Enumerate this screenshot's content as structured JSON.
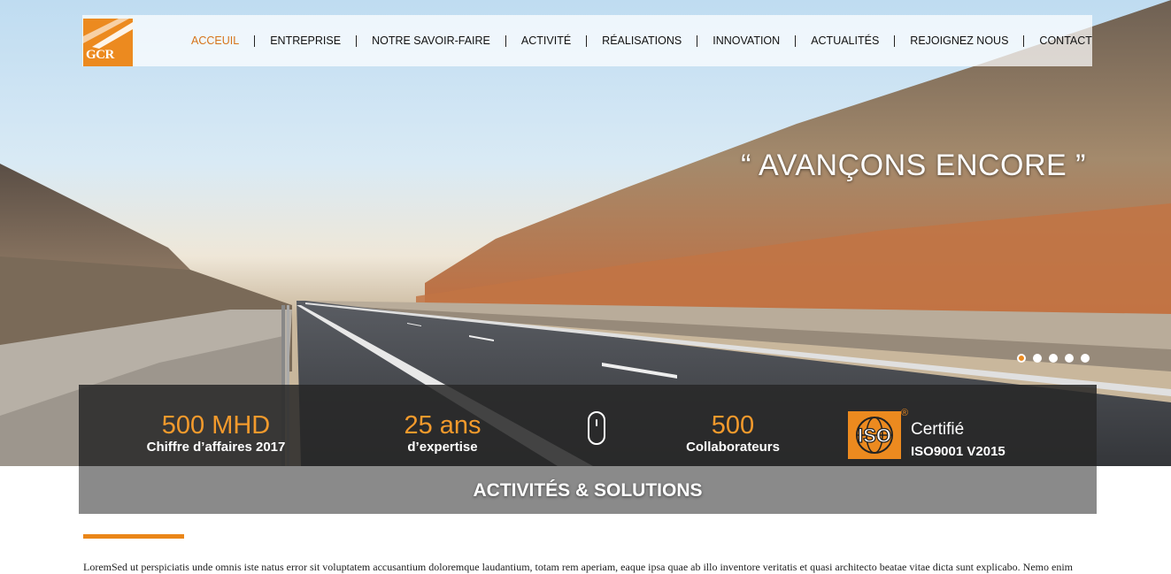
{
  "brand": {
    "logo_text": "GCR",
    "accent_color": "#ec8a1f"
  },
  "nav": {
    "items": [
      {
        "label": "ACCEUIL",
        "active": true
      },
      {
        "label": "ENTREPRISE"
      },
      {
        "label": "NOTRE SAVOIR-FAIRE"
      },
      {
        "label": "ACTIVITÉ"
      },
      {
        "label": "RÉALISATIONS"
      },
      {
        "label": "INNOVATION"
      },
      {
        "label": "ACTUALITÉS"
      },
      {
        "label": "REJOIGNEZ NOUS"
      },
      {
        "label": "CONTACT"
      }
    ]
  },
  "hero": {
    "slogan": "“ AVANÇONS ENCORE ”",
    "slides": {
      "count": 5,
      "active": 1
    }
  },
  "stats": {
    "revenue": {
      "value": "500 MHD",
      "label": "Chiffre d’affaires 2017"
    },
    "experience": {
      "value": "25 ans",
      "label": "d’expertise"
    },
    "staff": {
      "value": "500",
      "label": "Collaborateurs"
    },
    "iso": {
      "logo_text": "ISO",
      "reg": "®",
      "title": "Certifié",
      "standard": "ISO9001 V2015"
    }
  },
  "section": {
    "title": "ACTIVITÉS & SOLUTIONS"
  },
  "body": {
    "paragraph": "LoremSed ut perspiciatis unde omnis iste natus error sit voluptatem accusantium doloremque laudantium, totam rem aperiam, eaque ipsa quae ab illo inventore veritatis et quasi architecto beatae vitae dicta sunt explicabo. Nemo enim"
  }
}
